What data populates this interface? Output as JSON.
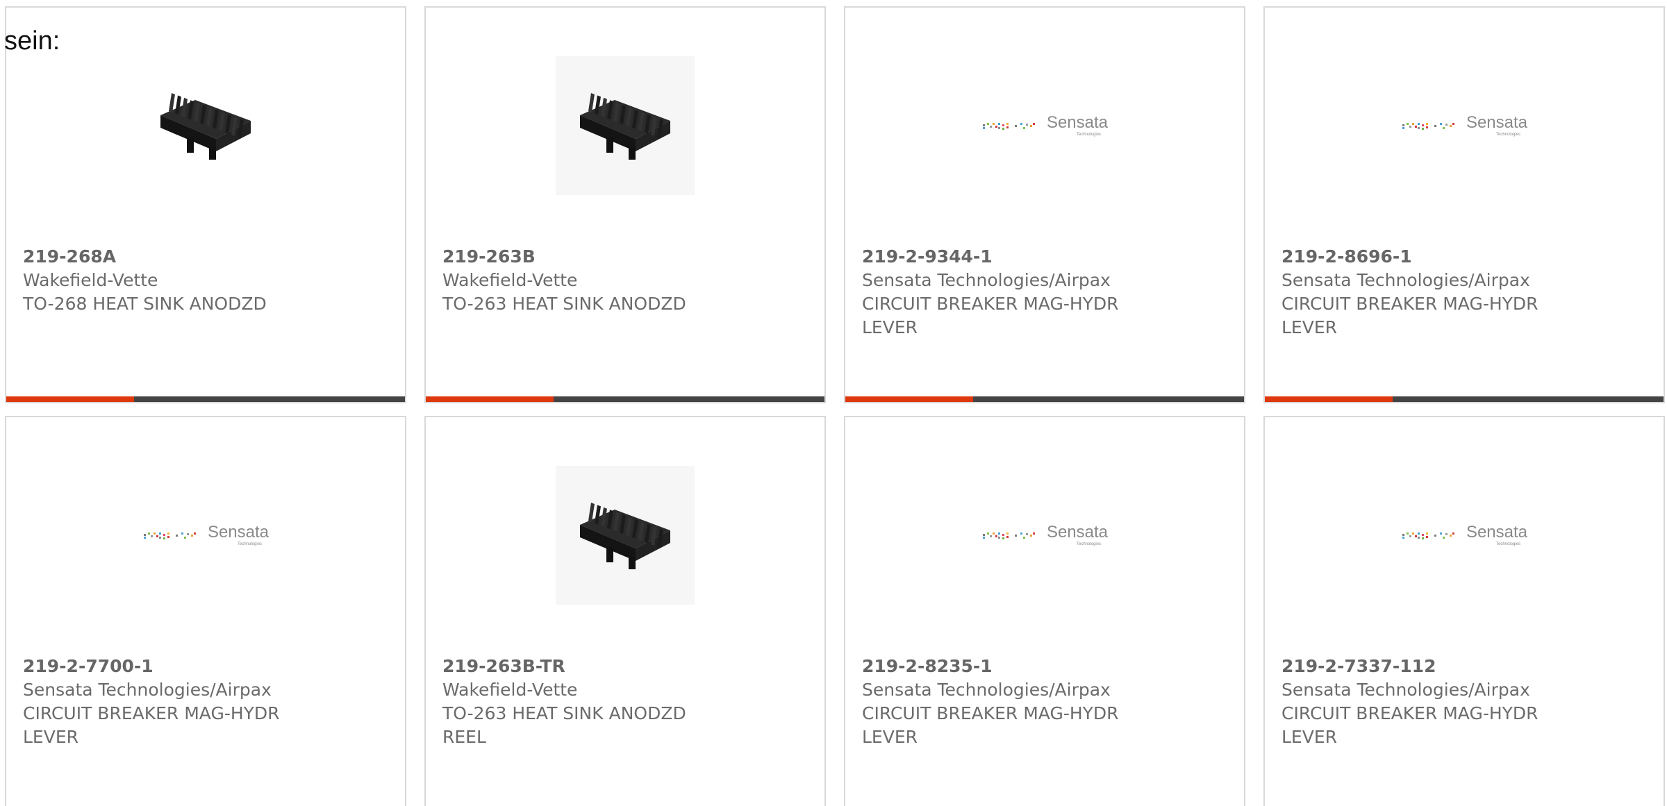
{
  "intro_text": "sein:",
  "colors": {
    "accent": "#e0380d",
    "bar": "#444444",
    "border": "#d9d9d9",
    "text": "#6b6b6b"
  },
  "progress_fraction": 0.32,
  "logo": {
    "name": "Sensata",
    "sub": "Technologies"
  },
  "products": [
    {
      "part_number": "219-268A",
      "manufacturer": "Wakefield-Vette",
      "description_line1": "TO-268 HEAT SINK ANODZD",
      "description_line2": "",
      "image": "heat-sink-icon"
    },
    {
      "part_number": "219-263B",
      "manufacturer": "Wakefield-Vette",
      "description_line1": "TO-263 HEAT SINK ANODZD",
      "description_line2": "",
      "image": "heat-sink-icon"
    },
    {
      "part_number": "219-2-9344-1",
      "manufacturer": "Sensata Technologies/Airpax",
      "description_line1": "CIRCUIT BREAKER MAG-HYDR",
      "description_line2": "LEVER",
      "image": "sensata-logo"
    },
    {
      "part_number": "219-2-8696-1",
      "manufacturer": "Sensata Technologies/Airpax",
      "description_line1": "CIRCUIT BREAKER MAG-HYDR",
      "description_line2": "LEVER",
      "image": "sensata-logo"
    },
    {
      "part_number": "219-2-7700-1",
      "manufacturer": "Sensata Technologies/Airpax",
      "description_line1": "CIRCUIT BREAKER MAG-HYDR",
      "description_line2": "LEVER",
      "image": "sensata-logo"
    },
    {
      "part_number": "219-263B-TR",
      "manufacturer": "Wakefield-Vette",
      "description_line1": "TO-263 HEAT SINK ANODZD",
      "description_line2": "REEL",
      "image": "heat-sink-icon"
    },
    {
      "part_number": "219-2-8235-1",
      "manufacturer": "Sensata Technologies/Airpax",
      "description_line1": "CIRCUIT BREAKER MAG-HYDR",
      "description_line2": "LEVER",
      "image": "sensata-logo"
    },
    {
      "part_number": "219-2-7337-112",
      "manufacturer": "Sensata Technologies/Airpax",
      "description_line1": "CIRCUIT BREAKER MAG-HYDR",
      "description_line2": "LEVER",
      "image": "sensata-logo"
    }
  ]
}
